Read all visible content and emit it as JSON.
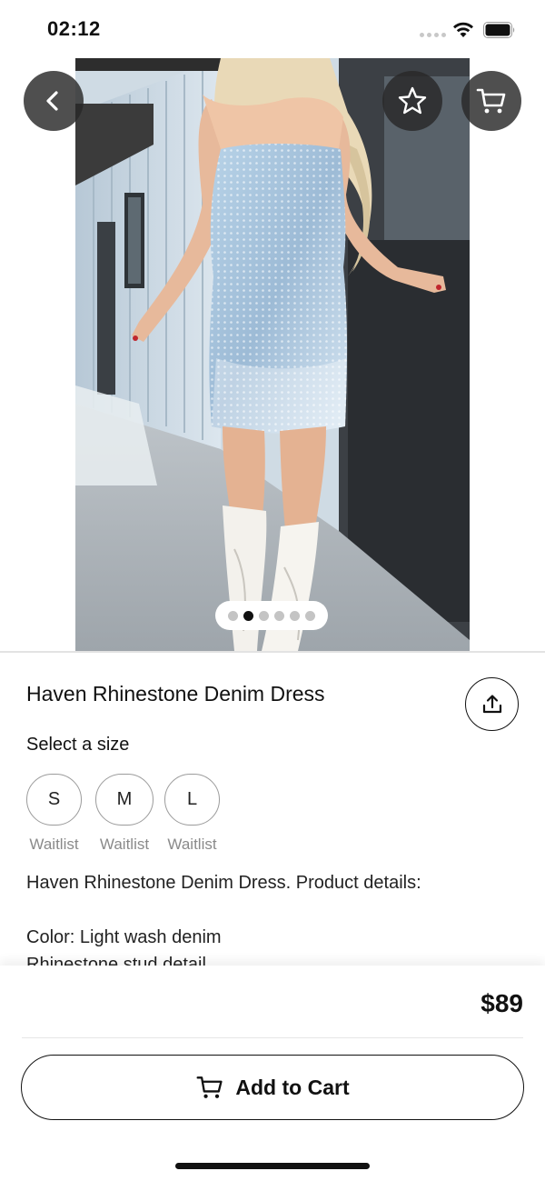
{
  "status_bar": {
    "time": "02:12"
  },
  "gallery": {
    "image_description": "Model wearing strapless light-wash denim mini dress with rhinestone studs and white cowboy boots",
    "page_count": 6,
    "active_page": 2
  },
  "header_actions": {
    "back_icon": "chevron-left-icon",
    "favorite_icon": "star-outline-icon",
    "cart_icon": "cart-icon"
  },
  "product": {
    "title": "Haven Rhinestone Denim Dress",
    "share_icon": "share-icon",
    "size_label": "Select a size",
    "sizes": [
      {
        "label": "S",
        "status": "Waitlist"
      },
      {
        "label": "M",
        "status": "Waitlist"
      },
      {
        "label": "L",
        "status": "Waitlist"
      }
    ],
    "description_lines": [
      "Haven Rhinestone Denim Dress. Product details:",
      "",
      "Color: Light wash denim",
      "Rhinestone stud detail"
    ]
  },
  "checkout": {
    "price": "$89",
    "add_to_cart_label": "Add to Cart",
    "add_to_cart_icon": "cart-icon"
  }
}
